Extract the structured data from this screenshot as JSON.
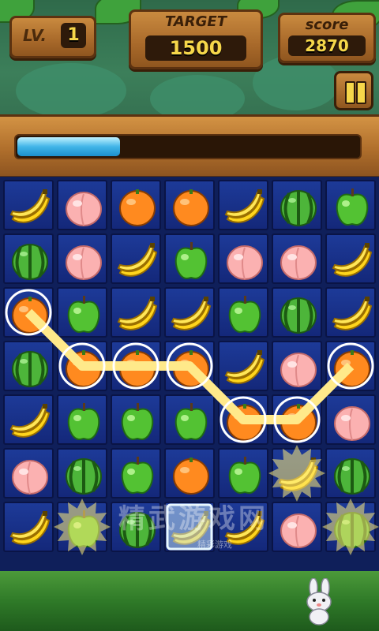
{
  "hud": {
    "level_label": "LV.",
    "level_value": "1",
    "target_label": "TARGET",
    "target_value": "1500",
    "score_label": "score",
    "score_value": "2870",
    "progress": 0.3
  },
  "watermark": {
    "text": "精武游戏网",
    "sub": "精彩游戏"
  },
  "colors": {
    "progress_fill": "#41b5e8",
    "board_tile": "#1d3a98",
    "wood": "#b06f2c",
    "hud_text": "#f6d74a"
  },
  "board": {
    "rows": 7,
    "cols": 7,
    "grid": [
      [
        "banana",
        "peach",
        "orange",
        "orange",
        "banana",
        "watermelon",
        "apple"
      ],
      [
        "watermelon",
        "peach",
        "banana",
        "apple",
        "peach",
        "peach",
        "banana"
      ],
      [
        "orange",
        "apple",
        "banana",
        "banana",
        "apple",
        "watermelon",
        "banana"
      ],
      [
        "watermelon",
        "orange",
        "orange",
        "orange",
        "banana",
        "peach",
        "orange"
      ],
      [
        "banana",
        "apple",
        "apple",
        "apple",
        "orange",
        "orange",
        "peach"
      ],
      [
        "peach",
        "watermelon",
        "apple",
        "orange",
        "apple",
        "banana",
        "watermelon"
      ],
      [
        "banana",
        "apple",
        "watermelon",
        "banana",
        "banana",
        "peach",
        "watermelon"
      ]
    ],
    "selected_path": [
      [
        2,
        0
      ],
      [
        3,
        1
      ],
      [
        3,
        2
      ],
      [
        3,
        3
      ],
      [
        4,
        4
      ],
      [
        4,
        5
      ],
      [
        3,
        6
      ]
    ],
    "sparkle_cells": [
      [
        5,
        5
      ],
      [
        6,
        1
      ],
      [
        6,
        6
      ]
    ],
    "ice_cells": [
      [
        6,
        3
      ]
    ]
  }
}
